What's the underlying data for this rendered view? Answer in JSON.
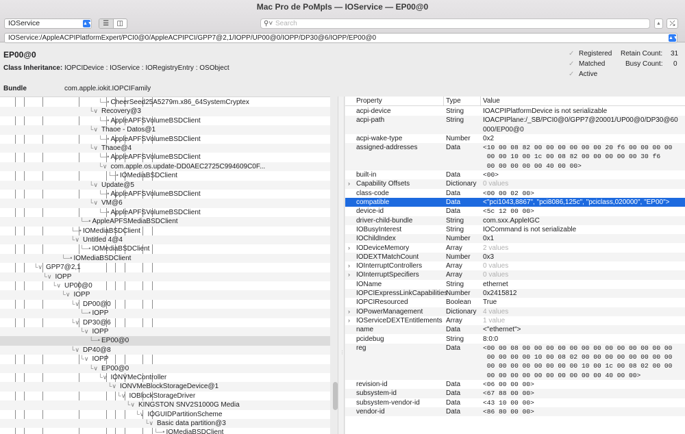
{
  "window": {
    "title": "Mac Pro de PoMpIs — IOService — EP00@0"
  },
  "toolbar": {
    "plane": "IOService",
    "view_list_icon": "list-icon",
    "view_column_icon": "columns-icon",
    "search_placeholder": "Search",
    "search_icon": "magnifier-icon",
    "pin_icon": "pin-icon"
  },
  "path": "IOService:/AppleACPIPlatformExpert/PCI0@0/AppleACPIPCI/GPP7@2,1/IOPP/UP00@0/IOPP/DP30@6/IOPP/EP00@0",
  "entry": {
    "name": "EP00@0",
    "inheritance_label": "Class Inheritance:",
    "inheritance": "IOPCIDevice : IOService : IORegistryEntry : OSObject",
    "bundle_label": "Bundle",
    "bundle": "com.apple.iokit.IOPCIFamily"
  },
  "status": {
    "registered": "Registered",
    "matched": "Matched",
    "active": "Active",
    "retain_label": "Retain Count:",
    "retain_value": "31",
    "busy_label": "Busy Count:",
    "busy_value": "0"
  },
  "tree": [
    {
      "label": "CheerSeed25A5279m.x86_64SystemCryptex",
      "depth": 9,
      "type": "leaf"
    },
    {
      "label": "Recovery@3",
      "depth": 8,
      "type": "open"
    },
    {
      "label": "AppleAPFSVolumeBSDClient",
      "depth": 9,
      "type": "leaf"
    },
    {
      "label": "Thaoe - Datos@1",
      "depth": 8,
      "type": "open"
    },
    {
      "label": "AppleAPFSVolumeBSDClient",
      "depth": 9,
      "type": "leaf"
    },
    {
      "label": "Thaoe@4",
      "depth": 8,
      "type": "open"
    },
    {
      "label": "AppleAPFSVolumeBSDClient",
      "depth": 9,
      "type": "leaf"
    },
    {
      "label": "com.apple.os.update-DD0AEC2725C994609C0F...",
      "depth": 9,
      "type": "open"
    },
    {
      "label": "IOMediaBSDClient",
      "depth": 10,
      "type": "leaf"
    },
    {
      "label": "Update@5",
      "depth": 8,
      "type": "open"
    },
    {
      "label": "AppleAPFSVolumeBSDClient",
      "depth": 9,
      "type": "leaf"
    },
    {
      "label": "VM@6",
      "depth": 8,
      "type": "open"
    },
    {
      "label": "AppleAPFSVolumeBSDClient",
      "depth": 9,
      "type": "leaf"
    },
    {
      "label": "AppleAPFSMediaBSDClient",
      "depth": 7,
      "type": "leaf"
    },
    {
      "label": "IOMediaBSDClient",
      "depth": 6,
      "type": "leaf"
    },
    {
      "label": "Untitled 4@4",
      "depth": 6,
      "type": "open"
    },
    {
      "label": "IOMediaBSDClient",
      "depth": 7,
      "type": "leaf"
    },
    {
      "label": "IOMediaBSDClient",
      "depth": 5,
      "type": "leaf"
    },
    {
      "label": "GPP7@2,1",
      "depth": 2,
      "type": "open"
    },
    {
      "label": "IOPP",
      "depth": 3,
      "type": "open"
    },
    {
      "label": "UP00@0",
      "depth": 4,
      "type": "open"
    },
    {
      "label": "IOPP",
      "depth": 5,
      "type": "open"
    },
    {
      "label": "DP00@0",
      "depth": 6,
      "type": "open"
    },
    {
      "label": "IOPP",
      "depth": 7,
      "type": "leaf"
    },
    {
      "label": "DP30@6",
      "depth": 6,
      "type": "open"
    },
    {
      "label": "IOPP",
      "depth": 7,
      "type": "open"
    },
    {
      "label": "EP00@0",
      "depth": 8,
      "type": "leaf",
      "selected": true
    },
    {
      "label": "DP40@8",
      "depth": 6,
      "type": "open"
    },
    {
      "label": "IOPP",
      "depth": 7,
      "type": "open"
    },
    {
      "label": "EP00@0",
      "depth": 8,
      "type": "open"
    },
    {
      "label": "IONVMeController",
      "depth": 9,
      "type": "open"
    },
    {
      "label": "IONVMeBlockStorageDevice@1",
      "depth": 10,
      "type": "open"
    },
    {
      "label": "IOBlockStorageDriver",
      "depth": 11,
      "type": "open"
    },
    {
      "label": "KINGSTON SNV2S1000G Media",
      "depth": 12,
      "type": "open"
    },
    {
      "label": "IOGUIDPartitionScheme",
      "depth": 13,
      "type": "open"
    },
    {
      "label": "Basic data partition@3",
      "depth": 14,
      "type": "open"
    },
    {
      "label": "IOMediaBSDClient",
      "depth": 15,
      "type": "leaf"
    }
  ],
  "properties": {
    "headers": {
      "property": "Property",
      "type": "Type",
      "value": "Value"
    },
    "rows": [
      {
        "name": "acpi-device",
        "type": "String",
        "value": "IOACPIPlatformDevice is not serializable",
        "lines": 1
      },
      {
        "name": "acpi-path",
        "type": "String",
        "value": "IOACPIPlane:/_SB/PCI0@0/GPP7@20001/UP00@0/DP30@60000/EP00@0",
        "lines": 2
      },
      {
        "name": "acpi-wake-type",
        "type": "Number",
        "value": "0x2",
        "lines": 1
      },
      {
        "name": "assigned-addresses",
        "type": "Data",
        "value": "<10 00 08 82 00 00 00 00 00 00 20 f6 00 00 00 00\n 00 00 10 00 1c 00 08 82 00 00 00 00 00 30 f6\n 00 00 00 00 00 40 00 00>",
        "lines": 3,
        "mono": true
      },
      {
        "name": "built-in",
        "type": "Data",
        "value": "<00>",
        "lines": 1,
        "mono": true
      },
      {
        "name": "Capability Offsets",
        "type": "Dictionary",
        "value": "0 values",
        "lines": 1,
        "expand": true,
        "dim": true
      },
      {
        "name": "class-code",
        "type": "Data",
        "value": "<00 00 02 00>",
        "lines": 1,
        "mono": true
      },
      {
        "name": "compatible",
        "type": "Data",
        "value": "<\"pci1043,8867\", \"pci8086,125c\", \"pciclass,020000\", \"EP00\">",
        "lines": 1,
        "selected": true
      },
      {
        "name": "device-id",
        "type": "Data",
        "value": "<5c 12 00 00>",
        "lines": 1,
        "mono": true
      },
      {
        "name": "driver-child-bundle",
        "type": "String",
        "value": "com.sxx.AppleIGC",
        "lines": 1
      },
      {
        "name": "IOBusyInterest",
        "type": "String",
        "value": "IOCommand is not serializable",
        "lines": 1
      },
      {
        "name": "IOChildIndex",
        "type": "Number",
        "value": "0x1",
        "lines": 1
      },
      {
        "name": "IODeviceMemory",
        "type": "Array",
        "value": "2 values",
        "lines": 1,
        "expand": true,
        "dim": true
      },
      {
        "name": "IODEXTMatchCount",
        "type": "Number",
        "value": "0x3",
        "lines": 1
      },
      {
        "name": "IOInterruptControllers",
        "type": "Array",
        "value": "0 values",
        "lines": 1,
        "expand": true,
        "dim": true
      },
      {
        "name": "IOInterruptSpecifiers",
        "type": "Array",
        "value": "0 values",
        "lines": 1,
        "expand": true,
        "dim": true
      },
      {
        "name": "IOName",
        "type": "String",
        "value": "ethernet",
        "lines": 1
      },
      {
        "name": "IOPCIExpressLinkCapabilities",
        "type": "Number",
        "value": "0x2415812",
        "lines": 1
      },
      {
        "name": "IOPCIResourced",
        "type": "Boolean",
        "value": "True",
        "lines": 1
      },
      {
        "name": "IOPowerManagement",
        "type": "Dictionary",
        "value": "4 values",
        "lines": 1,
        "expand": true,
        "dim": true
      },
      {
        "name": "IOServiceDEXTEntitlements",
        "type": "Array",
        "value": "1 value",
        "lines": 1,
        "expand": true,
        "dim": true
      },
      {
        "name": "name",
        "type": "Data",
        "value": "<\"ethernet\">",
        "lines": 1
      },
      {
        "name": "pcidebug",
        "type": "String",
        "value": "8:0:0",
        "lines": 1
      },
      {
        "name": "reg",
        "type": "Data",
        "value": "<00 00 08 00 00 00 00 00 00 00 00 00 00 00 00 00\n 00 00 00 00 10 00 08 02 00 00 00 00 00 00 00 00\n 00 00 00 00 00 00 00 00 10 00 1c 00 08 02 00 00\n 00 00 00 00 00 00 00 00 00 00 40 00 00>",
        "lines": 4,
        "mono": true
      },
      {
        "name": "revision-id",
        "type": "Data",
        "value": "<06 00 00 00>",
        "lines": 1,
        "mono": true
      },
      {
        "name": "subsystem-id",
        "type": "Data",
        "value": "<67 88 00 00>",
        "lines": 1,
        "mono": true
      },
      {
        "name": "subsystem-vendor-id",
        "type": "Data",
        "value": "<43 10 00 00>",
        "lines": 1,
        "mono": true
      },
      {
        "name": "vendor-id",
        "type": "Data",
        "value": "<86 80 00 00>",
        "lines": 1,
        "mono": true
      }
    ]
  },
  "colors": {
    "selection": "#1d6adf",
    "tree_selection": "#dcdcdc",
    "accent": "#2f7ef6"
  }
}
